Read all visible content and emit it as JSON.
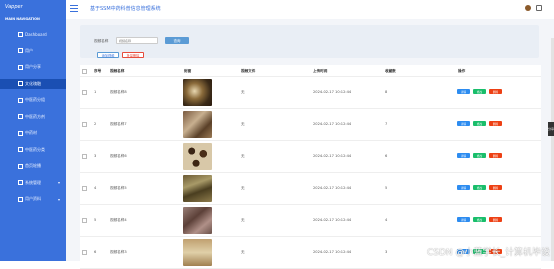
{
  "sidebar": {
    "logo": "Vapper",
    "nav_title": "MAIN NAVIGATION",
    "items": [
      {
        "label": "Dashboard",
        "icon": "dashboard-icon"
      },
      {
        "label": "用户",
        "icon": "user-icon"
      },
      {
        "label": "用户分享",
        "icon": "share-icon"
      },
      {
        "label": "文化瑰融",
        "icon": "book-icon",
        "active": true
      },
      {
        "label": "中医药分组",
        "icon": "folder-icon"
      },
      {
        "label": "中医药方剂",
        "icon": "recipe-icon"
      },
      {
        "label": "中药材",
        "icon": "herb-icon"
      },
      {
        "label": "中医药分类",
        "icon": "category-icon"
      },
      {
        "label": "首页轮播",
        "icon": "carousel-icon"
      },
      {
        "label": "系统管理",
        "icon": "settings-icon",
        "expandable": true
      },
      {
        "label": "用户资料",
        "icon": "profile-icon",
        "expandable": true
      }
    ]
  },
  "header": {
    "title": "基于SSM中药科普信息管理系统"
  },
  "search": {
    "label": "视频名称",
    "placeholder": "视频名称",
    "button": "查询"
  },
  "actions": {
    "add": "添加视频",
    "delete": "批量删除"
  },
  "table": {
    "columns": [
      "序号",
      "视频名称",
      "封面",
      "视频文件",
      "上传时间",
      "收藏数",
      "操作"
    ],
    "rows": [
      {
        "index": "1",
        "name": "视频名称8",
        "file": "无",
        "time": "2024-02-17 10:12:44",
        "favorites": "8",
        "img": "img1"
      },
      {
        "index": "2",
        "name": "视频名称7",
        "file": "无",
        "time": "2024-02-17 10:12:44",
        "favorites": "7",
        "img": "img2"
      },
      {
        "index": "3",
        "name": "视频名称6",
        "file": "无",
        "time": "2024-02-17 10:12:44",
        "favorites": "6",
        "img": "img3"
      },
      {
        "index": "4",
        "name": "视频名称5",
        "file": "无",
        "time": "2024-02-17 10:12:44",
        "favorites": "5",
        "img": "img4"
      },
      {
        "index": "5",
        "name": "视频名称4",
        "file": "无",
        "time": "2024-02-17 10:12:44",
        "favorites": "4",
        "img": "img5"
      },
      {
        "index": "6",
        "name": "视频名称3",
        "file": "无",
        "time": "2024-02-17 10:12:44",
        "favorites": "3",
        "img": "img6"
      }
    ],
    "op_labels": {
      "view": "详情",
      "edit": "修改",
      "delete": "删除"
    }
  },
  "side_tab": "分享",
  "watermark": "CSDN @小蓝学长_计算机毕设"
}
